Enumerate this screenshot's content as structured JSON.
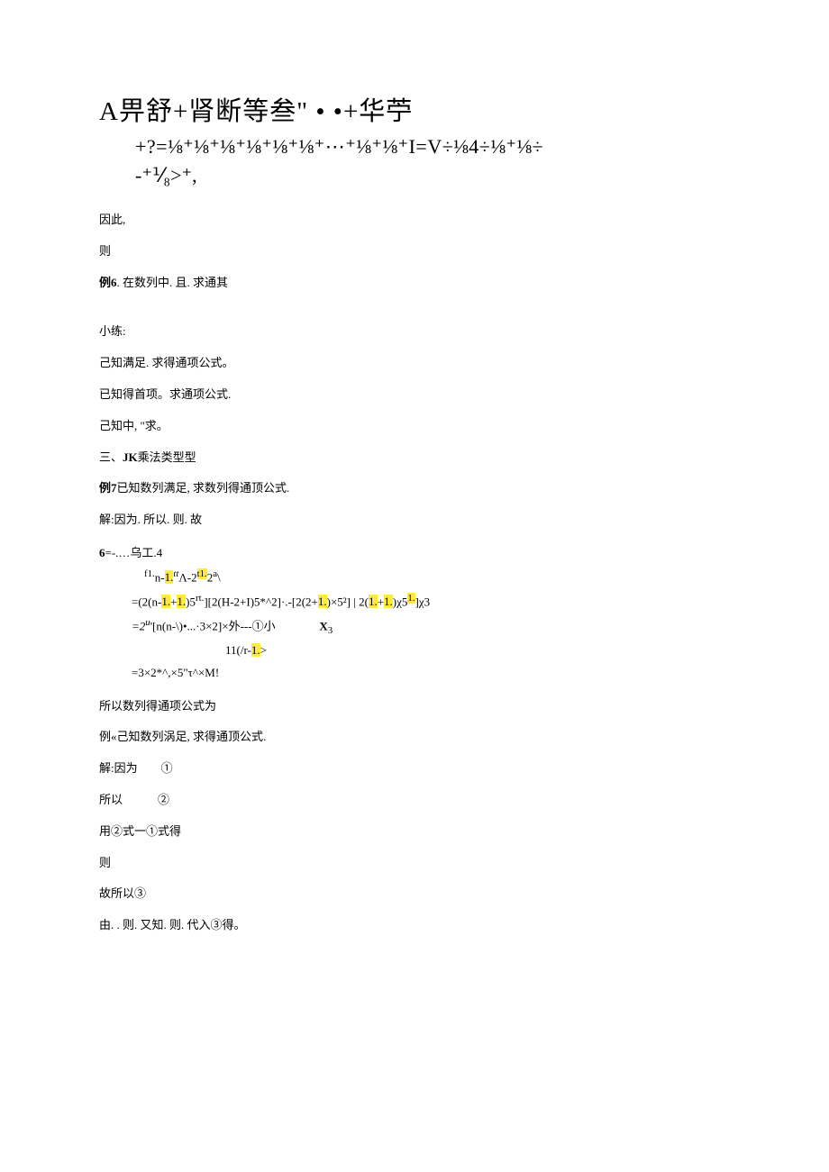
{
  "title": {
    "line1": "A畀舒+肾断等叁\" • •+华苧",
    "line2": "+?=⅛⁺⅛⁺⅛⁺⅛⁺⅛⁺⅛⁺⋯⁺⅛⁺⅛⁺I=V÷⅛4÷⅛⁺⅛÷",
    "line3": "-⁺⅟₈>⁺,"
  },
  "p1": "因此,",
  "p2": "则",
  "p3_a": "例6",
  "p3_b": ". 在数列中. 且. 求通其",
  "p4": "小练:",
  "p5": "己知满足. 求得通项公式。",
  "p6": "已知得首项。求通项公式.",
  "p7": "己知中, \"求。",
  "p8_a": "三、",
  "p8_b": "JK",
  "p8_c": "乘法类型型",
  "p9_a": "例7",
  "p9_b": "已知数列满足, 求数列得通顶公式.",
  "p10": "解:因为. 所以. 则. 故",
  "eq": {
    "l1a": "6",
    "l1b": "=-.…乌工.4",
    "l2a": "f1.",
    "l2b": "n-",
    "l2c": "1.",
    "l2d": "tt",
    "l2e": "Λ-2",
    "l2f": "t1.",
    "l2g": "2",
    "l2h": "a",
    "l2i": "\\",
    "l3a": "=(2(n-",
    "l3b": "1.",
    "l3c": "+",
    "l3d": "1.",
    "l3e": ")5",
    "l3f": "rt.",
    "l3g": "][2(H-2+I)5*^2]·.-[2(2+",
    "l3h": "1.",
    "l3i": ")×5²] | 2(",
    "l3j": "1.",
    "l3k": "+",
    "l3l": "1.",
    "l3m": ")χ5",
    "l3n": "1.",
    "l3o": "]χ3",
    "l4a": "=2",
    "l4b": "u",
    "l4c": "'[n(n-\\)•...·3×2]×外---①小",
    "l4d": "X",
    "l4e": "3",
    "l5a": "11(/r-",
    "l5b": "1.",
    "l5c": ">",
    "l6": "=3×2*^,×5\"τ^×M!"
  },
  "p11": "所以数列得通项公式为",
  "p12": "例«己知数列涡足, 求得通顶公式.",
  "p13": "解:因为　　①",
  "p14": "所以　　　②",
  "p15": "用②式一①式得",
  "p16": "则",
  "p17": "故所以③",
  "p18": "由. . 则. 又知. 则. 代入③得。"
}
